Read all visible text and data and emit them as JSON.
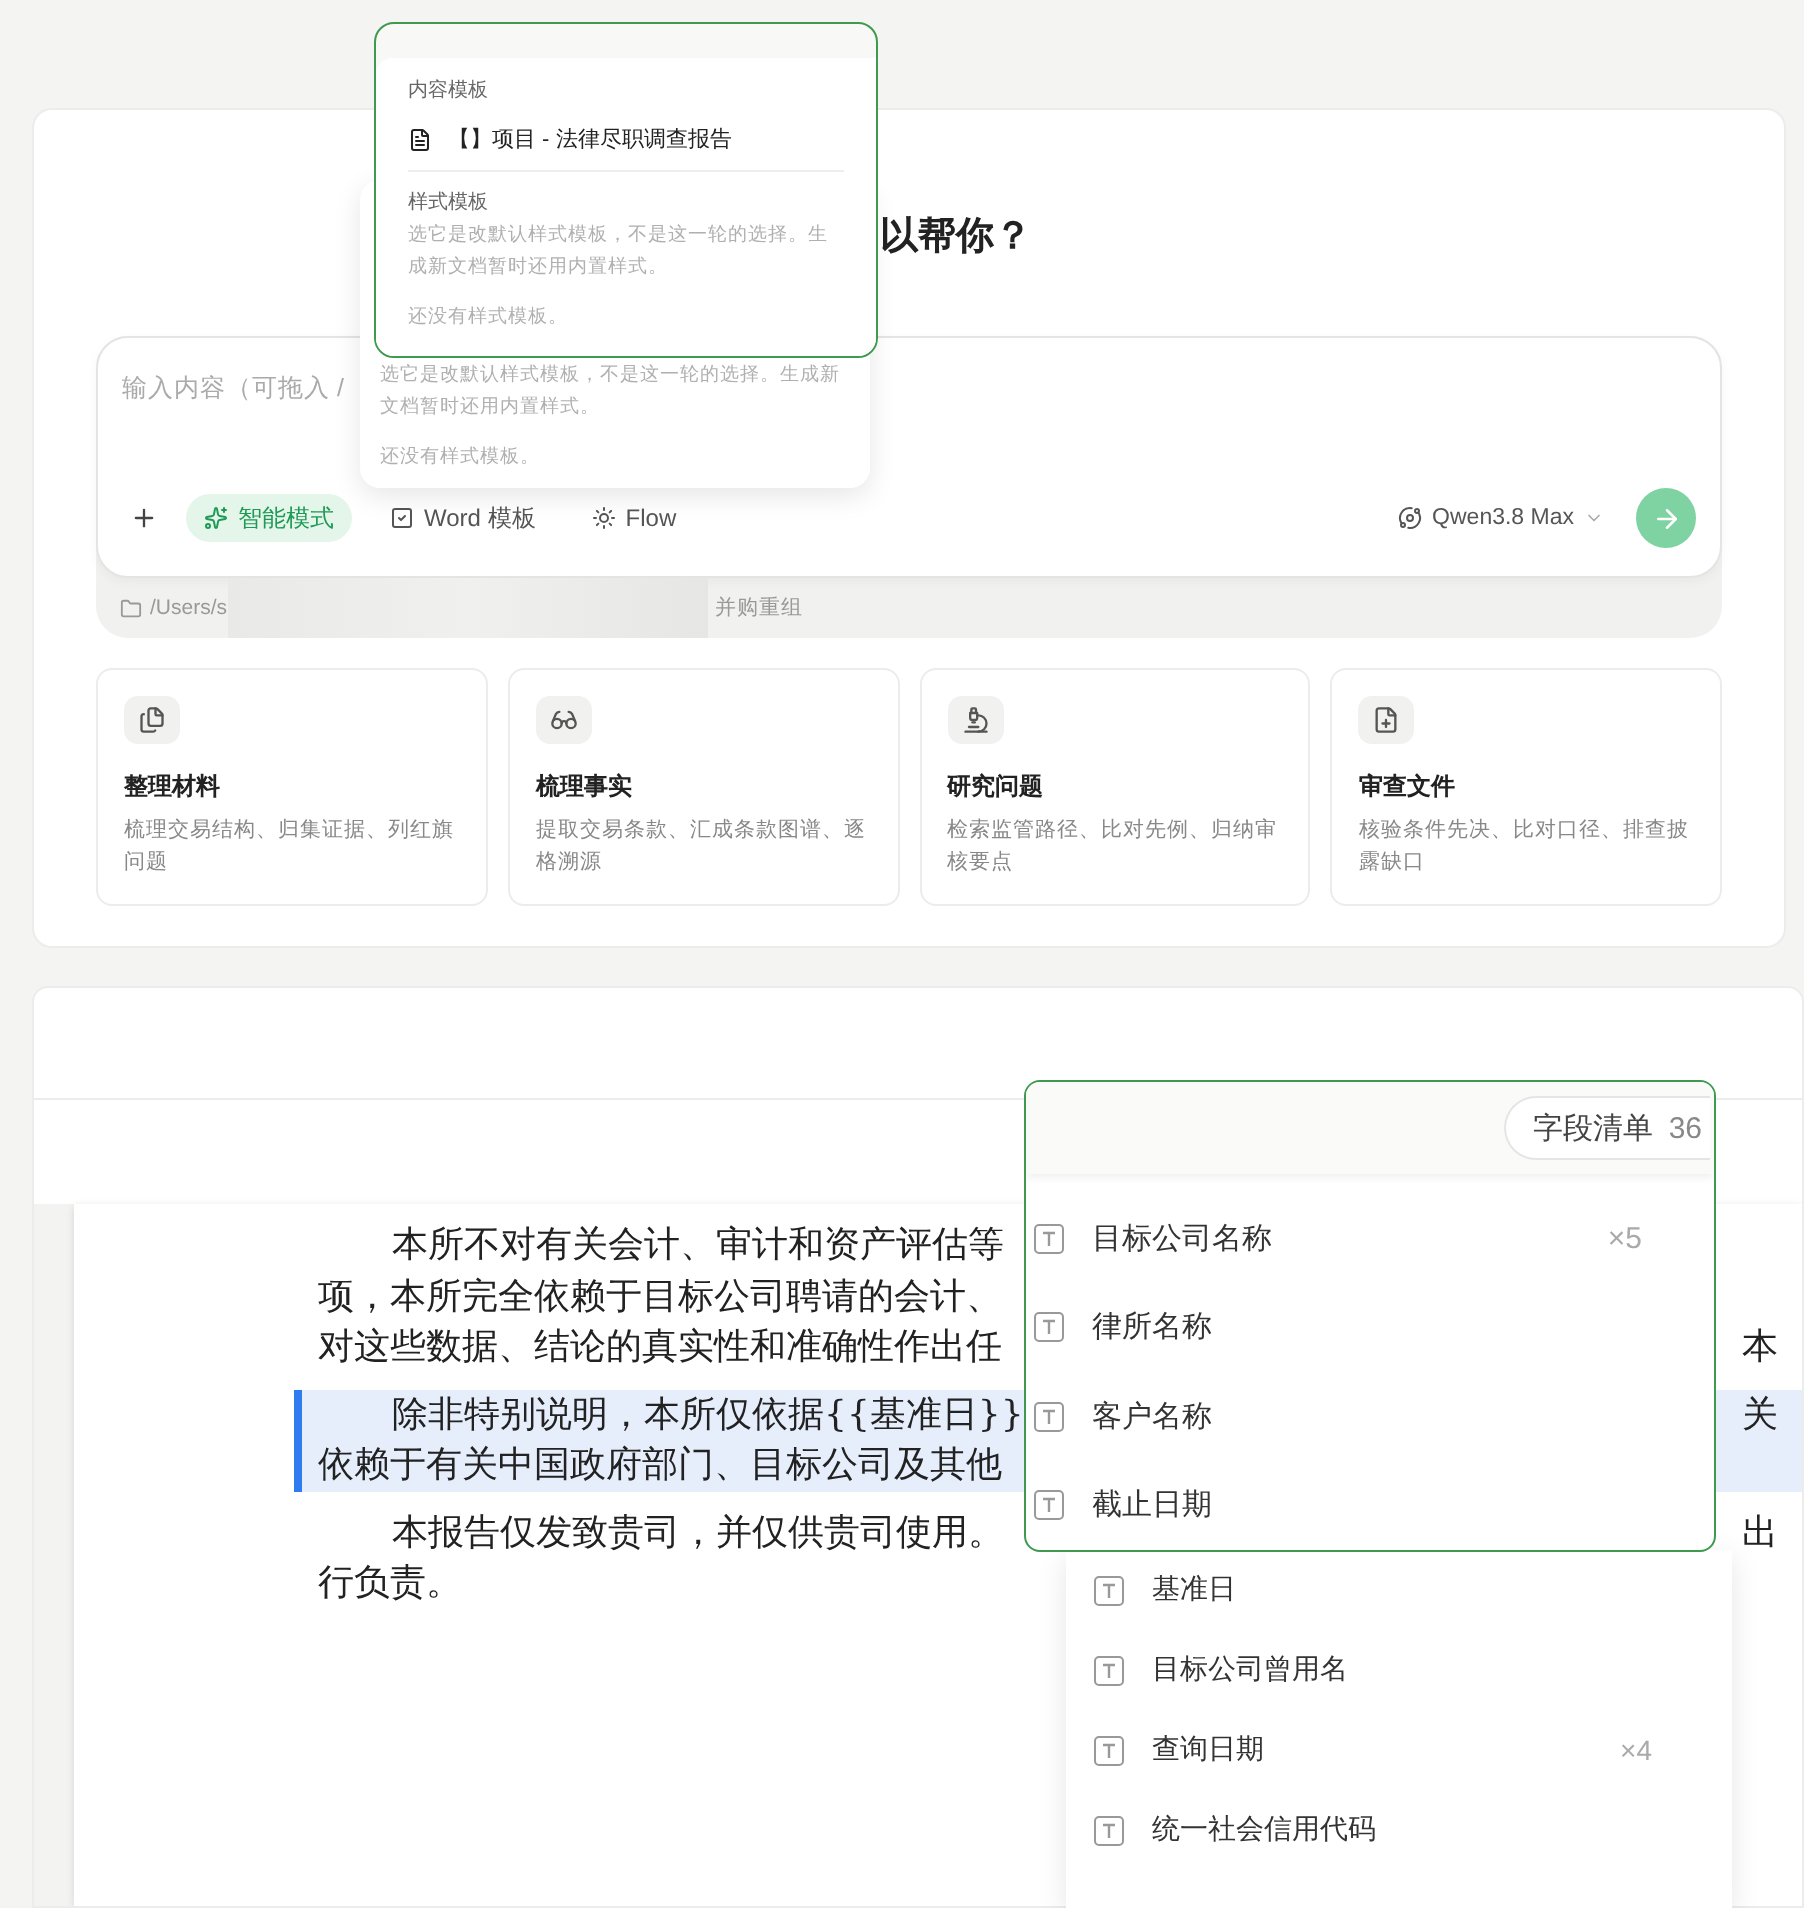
{
  "heading": "以帮你？",
  "content_template_popup": {
    "section_label": "内容模板",
    "items": [
      {
        "label": "【】项目 - 法律尽职调查报告"
      }
    ],
    "style_section_label": "样式模板",
    "style_note": "选它是改默认样式模板，不是这一轮的选择。生成新文档暂时还用内置样式。",
    "style_empty": "还没有样式模板。"
  },
  "style_template_dropdown": {
    "note": "选它是改默认样式模板，不是这一轮的选择。生成新文档暂时还用内置样式。",
    "empty": "还没有样式模板。"
  },
  "composer": {
    "placeholder": "输入内容（可拖入 /",
    "modes": [
      {
        "kind": "smart",
        "label": "智能模式",
        "selected": true
      },
      {
        "kind": "word",
        "label": "Word 模板",
        "selected": false
      },
      {
        "kind": "flow",
        "label": "Flow",
        "selected": false
      }
    ],
    "model": "Qwen3.8 Max"
  },
  "path_bar": {
    "path_start": "/Users/s",
    "path_end": "并购重组"
  },
  "task_cards": [
    {
      "kind": "materials",
      "title": "整理材料",
      "description": "梳理交易结构、归集证据、列红旗问题"
    },
    {
      "kind": "facts",
      "title": "梳理事实",
      "description": "提取交易条款、汇成条款图谱、逐格溯源"
    },
    {
      "kind": "research",
      "title": "研究问题",
      "description": "检索监管路径、比对先例、归纳审核要点"
    },
    {
      "kind": "review",
      "title": "审查文件",
      "description": "核验条件先决、比对口径、排查披露缺口"
    }
  ],
  "document": {
    "paragraphs": [
      {
        "highlighted": false,
        "lines": [
          {
            "text": "本所不对有关会计、审计和资产评估等"
          },
          {
            "text": "项，本所完全依赖于目标公司聘请的会计、"
          },
          {
            "text": "对这些数据、结论的真实性和准确性作出任",
            "right": "本"
          }
        ]
      },
      {
        "highlighted": true,
        "lines": [
          {
            "text": "除非特别说明，本所仅依据{{基准日}}",
            "right": "关"
          },
          {
            "text": "依赖于有关中国政府部门、目标公司及其他"
          }
        ]
      },
      {
        "highlighted": false,
        "lines": [
          {
            "text": "本报告仅发致贵司，并仅供贵司使用。",
            "right": "出"
          },
          {
            "text": "行负责。"
          }
        ]
      }
    ]
  },
  "field_list_popup": {
    "title": "字段清单",
    "count": "36",
    "fields": [
      {
        "name": "目标公司名称",
        "count": "×5"
      },
      {
        "name": "律所名称"
      },
      {
        "name": "客户名称"
      },
      {
        "name": "截止日期"
      }
    ]
  },
  "field_list_back": {
    "fields": [
      {
        "name": "基准日"
      },
      {
        "name": "目标公司曾用名"
      },
      {
        "name": "查询日期",
        "count": "×4"
      },
      {
        "name": "统一社会信用代码"
      }
    ]
  }
}
